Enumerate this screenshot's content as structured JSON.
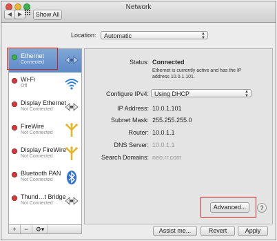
{
  "window": {
    "title": "Network"
  },
  "toolbar": {
    "show_all_label": "Show All",
    "back_glyph": "◀",
    "forward_glyph": "▶"
  },
  "location": {
    "label": "Location:",
    "value": "Automatic"
  },
  "services": [
    {
      "name": "Ethernet",
      "status": "Connected",
      "dot_color": "#38b44a",
      "icon": "ethernet-arrows-icon",
      "selected": true
    },
    {
      "name": "Wi-Fi",
      "status": "Off",
      "dot_color": "#d83a3a",
      "icon": "wifi-icon",
      "selected": false
    },
    {
      "name": "Display Ethernet",
      "status": "Not Connected",
      "dot_color": "#d83a3a",
      "icon": "ethernet-arrows-icon",
      "selected": false
    },
    {
      "name": "FireWire",
      "status": "Not Connected",
      "dot_color": "#d83a3a",
      "icon": "firewire-icon",
      "selected": false
    },
    {
      "name": "Display FireWire",
      "status": "Not Connected",
      "dot_color": "#d83a3a",
      "icon": "firewire-icon",
      "selected": false
    },
    {
      "name": "Bluetooth PAN",
      "status": "Not Connected",
      "dot_color": "#d83a3a",
      "icon": "bluetooth-icon",
      "selected": false
    },
    {
      "name": "Thund…t Bridge",
      "status": "Not Connected",
      "dot_color": "#d83a3a",
      "icon": "ethernet-arrows-icon",
      "selected": false
    }
  ],
  "sidebar_footer": {
    "add": "+",
    "remove": "−",
    "gear": "⚙▾"
  },
  "details": {
    "status_label": "Status:",
    "status_value": "Connected",
    "status_desc": "Ethernet is currently active and has the IP address 10.0.1.101.",
    "configure_label": "Configure IPv4:",
    "configure_value": "Using DHCP",
    "ip_label": "IP Address:",
    "ip_value": "10.0.1.101",
    "subnet_label": "Subnet Mask:",
    "subnet_value": "255.255.255.0",
    "router_label": "Router:",
    "router_value": "10.0.1.1",
    "dns_label": "DNS Server:",
    "dns_value": "10.0.1.1",
    "search_label": "Search Domains:",
    "search_value": "neo.rr.com"
  },
  "buttons": {
    "advanced": "Advanced...",
    "help": "?",
    "assist": "Assist me...",
    "revert": "Revert",
    "apply": "Apply"
  },
  "colors": {
    "accent_selected": "#5d89c6",
    "highlight_box": "#d62020"
  }
}
